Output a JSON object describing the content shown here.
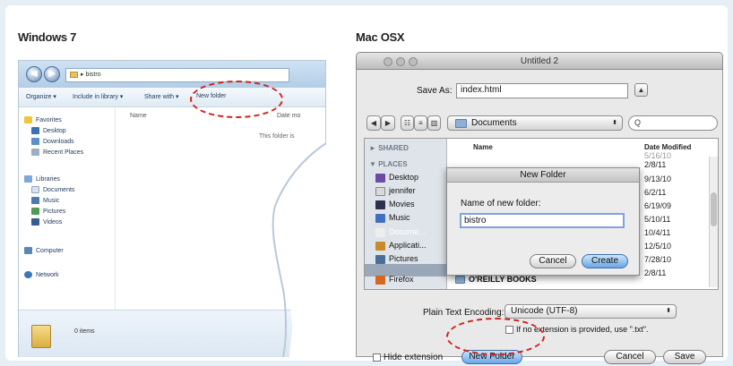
{
  "headings": {
    "windows": "Windows 7",
    "mac": "Mac OSX"
  },
  "windows": {
    "address_path": "bistro",
    "nav_back": "◀",
    "nav_forward": "▶",
    "toolbar": {
      "organize": "Organize ▾",
      "include": "Include in library ▾",
      "share": "Share with ▾",
      "new_folder": "New folder"
    },
    "columns": {
      "name": "Name",
      "date": "Date mo"
    },
    "empty_message": "This folder is",
    "favorites_label": "Favorites",
    "favorites": [
      "Desktop",
      "Downloads",
      "Recent Places"
    ],
    "libraries_label": "Libraries",
    "libraries": [
      "Documents",
      "Music",
      "Pictures",
      "Videos"
    ],
    "computer": "Computer",
    "network": "Network",
    "status_items": "0 items"
  },
  "mac": {
    "window_title": "Untitled 2",
    "save_as_label": "Save As:",
    "save_as_value": "index.html",
    "disclosure_glyph": "▲",
    "view_back": "◀",
    "view_forward": "▶",
    "view_icons": "☷",
    "view_list": "≡",
    "view_columns": "▥",
    "location": "Documents",
    "popup_arrow": "⬍",
    "search_placeholder": "Q",
    "shared_label": "► SHARED",
    "places_label": "▼ PLACES",
    "places": [
      "Desktop",
      "jennifer",
      "Movies",
      "Music",
      "Docume...",
      "Applicati...",
      "Pictures",
      "Firefox"
    ],
    "col_name": "Name",
    "col_date": "Date Modified",
    "dates": [
      "5/16/10",
      "2/8/11",
      "9/13/10",
      "6/2/11",
      "6/19/09",
      "5/10/11",
      "10/4/11",
      "12/5/10",
      "7/28/10",
      "2/8/11"
    ],
    "last_item": "O'REILLY BOOKS",
    "dialog": {
      "title": "New Folder",
      "prompt": "Name of new folder:",
      "value": "bistro",
      "cancel": "Cancel",
      "create": "Create"
    },
    "encoding_label": "Plain Text Encoding:",
    "encoding_value": "Unicode (UTF-8)",
    "no_extension_text": "If no extension is provided, use \".txt\".",
    "hide_extension": "Hide extension",
    "new_folder_button": "New Folder",
    "cancel_button": "Cancel",
    "save_button": "Save"
  },
  "colors": {
    "highlight_ring": "#d0231c",
    "win_accent": "#b3cde6",
    "mac_button_blue": "#6aa6e6"
  }
}
